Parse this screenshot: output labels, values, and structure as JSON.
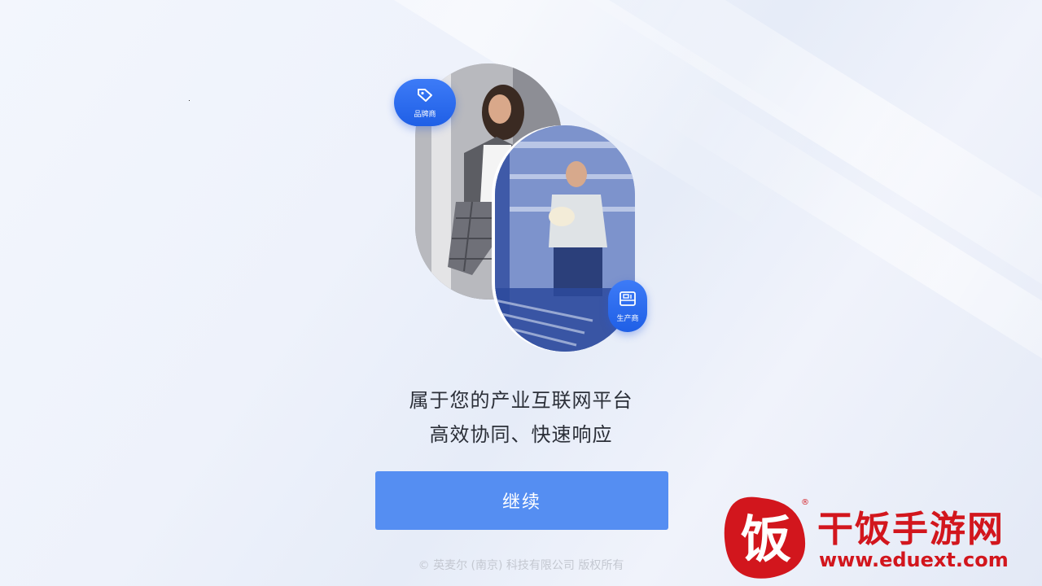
{
  "hero": {
    "badge_brand": {
      "label": "品牌商",
      "icon": "tag-icon"
    },
    "badge_maker": {
      "label": "生产商",
      "icon": "sewing-machine-icon"
    }
  },
  "tagline": {
    "line1": "属于您的产业互联网平台",
    "line2": "高效协同、快速响应"
  },
  "continue_button": {
    "label": "继续"
  },
  "footer": {
    "copyright": "© 英麦尔 (南京) 科技有限公司 版权所有"
  },
  "watermark": {
    "logo_char": "饭",
    "title": "干饭手游网",
    "url": "www.eduext.com",
    "reg_mark": "®"
  },
  "colors": {
    "accent": "#558ef2",
    "badge": "#2566ec",
    "watermark": "#d2161d"
  }
}
